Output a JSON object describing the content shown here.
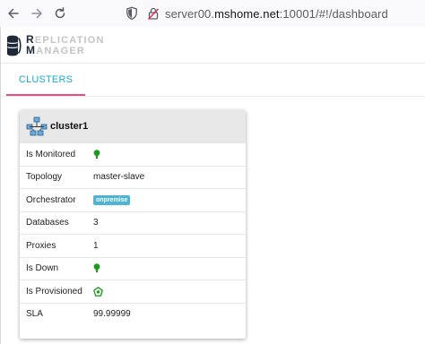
{
  "browser": {
    "url_prefix": "server00.",
    "url_host": "mshome.net",
    "url_suffix": ":10001/#!/dashboard"
  },
  "logo": {
    "line1_cap": "R",
    "line1_rest": "EPLICATION",
    "line2_cap": "M",
    "line2_rest": "ANAGER"
  },
  "tabs": [
    {
      "label": "CLUSTERS",
      "active": true
    }
  ],
  "accent_colors": {
    "tab_text": "#1ba9c9",
    "tab_ink": "#e94c7d",
    "badge": "#4fb3d6",
    "status_green": "#1a9c1a"
  },
  "cluster": {
    "name": "cluster1",
    "icon": "cluster-topology-icon",
    "rows": [
      {
        "label": "Is Monitored",
        "value": "",
        "icon": "bulb-on-icon"
      },
      {
        "label": "Topology",
        "value": "master-slave"
      },
      {
        "label": "Orchestrator",
        "value": "onpremise",
        "badge": true
      },
      {
        "label": "Databases",
        "value": "3"
      },
      {
        "label": "Proxies",
        "value": "1"
      },
      {
        "label": "Is Down",
        "value": "",
        "icon": "bulb-on-icon"
      },
      {
        "label": "Is Provisioned",
        "value": "",
        "icon": "provisioned-icon"
      },
      {
        "label": "SLA",
        "value": "99.99999"
      }
    ]
  }
}
